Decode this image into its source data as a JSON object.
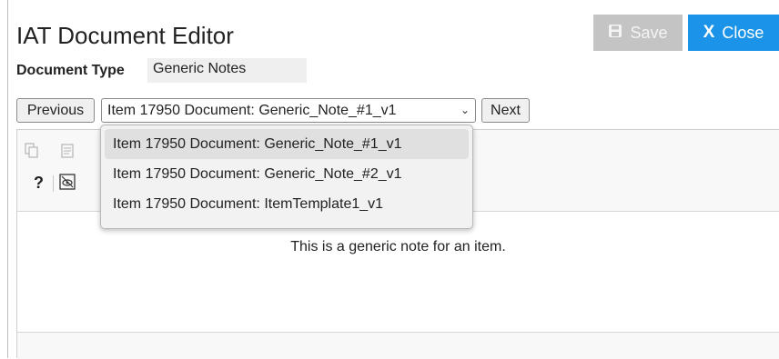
{
  "app": {
    "title": "IAT Document Editor"
  },
  "toolbar": {
    "save_label": "Save",
    "close_label": "Close",
    "close_glyph": "X"
  },
  "document_type": {
    "label": "Document Type",
    "value": "Generic Notes"
  },
  "navigation": {
    "previous_label": "Previous",
    "next_label": "Next",
    "selected": "Item 17950 Document: Generic_Note_#1_v1",
    "options": [
      "Item 17950 Document: Generic_Note_#1_v1",
      "Item 17950 Document: Generic_Note_#2_v1",
      "Item 17950 Document: ItemTemplate1_v1"
    ]
  },
  "editor": {
    "help_glyph": "?",
    "content": "This is a generic note for an item.",
    "icons": [
      "copy-icon",
      "paste-icon",
      "help-icon",
      "preview-icon"
    ]
  },
  "colors": {
    "close_button": "#1a93e8",
    "save_button_disabled": "#c4c4c4"
  }
}
